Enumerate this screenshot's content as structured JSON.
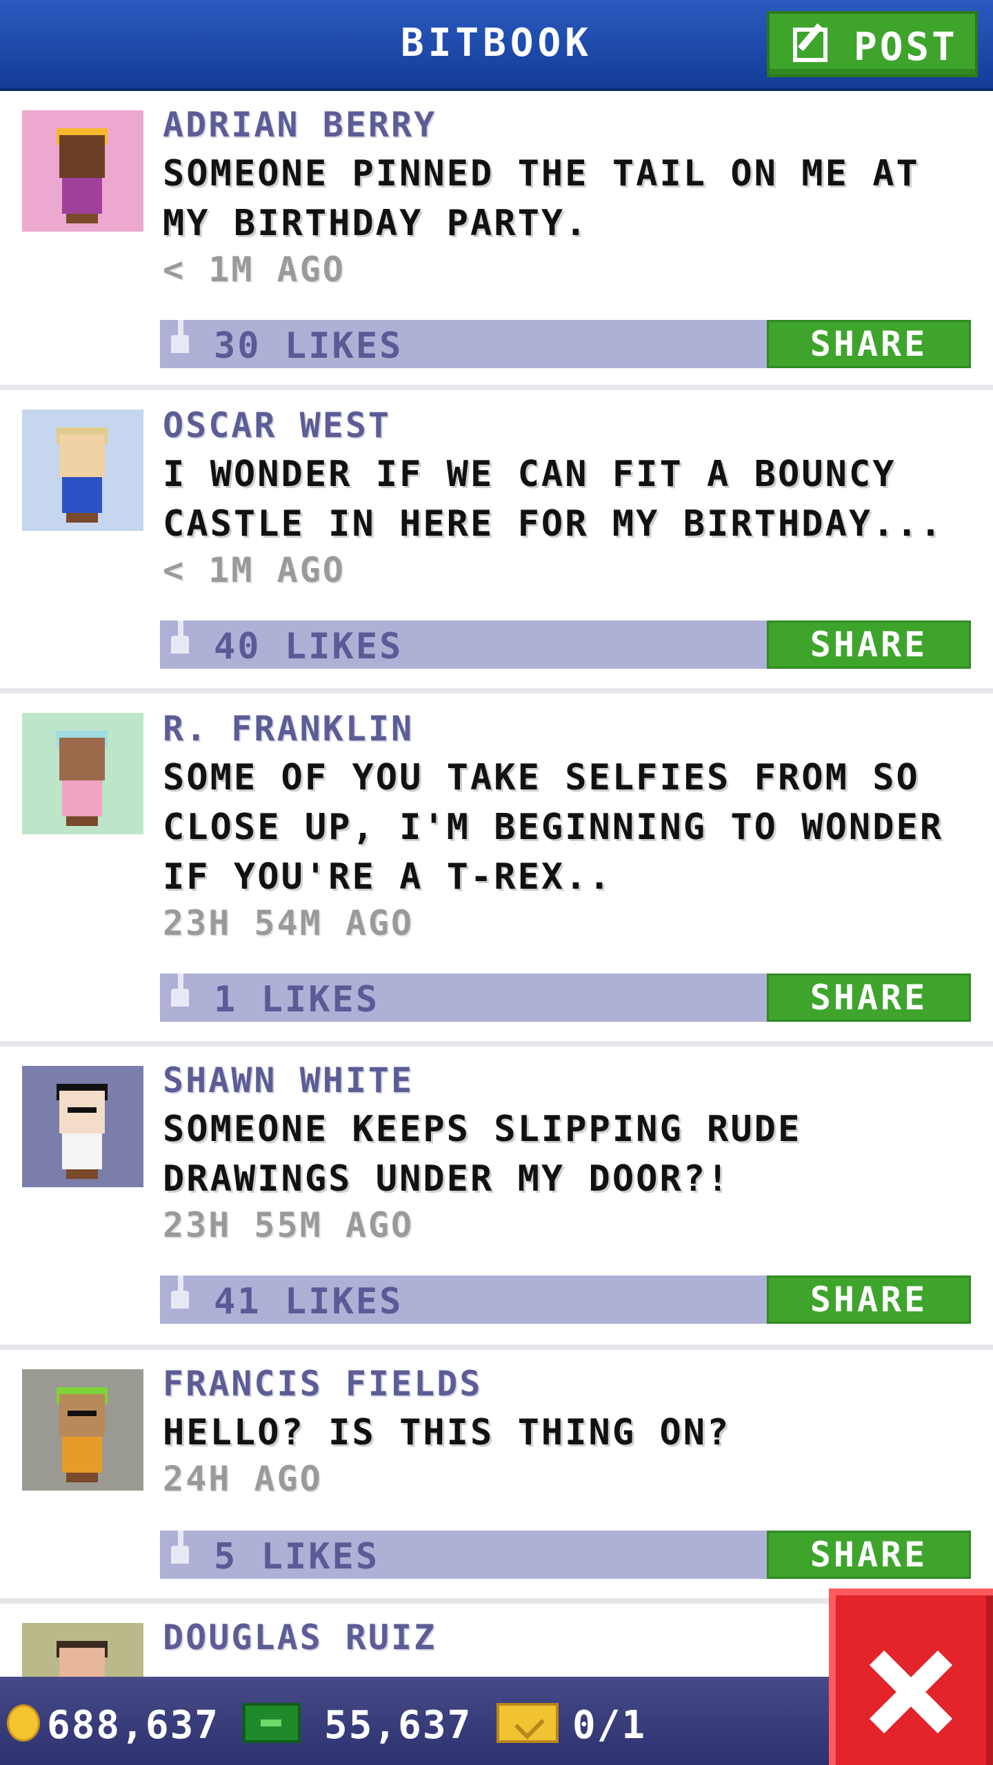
{
  "header": {
    "title": "BITBOOK",
    "post_label": "POST"
  },
  "posts": [
    {
      "author": "ADRIAN BERRY",
      "message": "SOMEONE PINNED THE TAIL ON ME AT MY BIRTHDAY PARTY.",
      "time": "< 1M AGO",
      "likes": "30 LIKES",
      "share_label": "SHARE",
      "avatar_bg": "#eda8cf",
      "skin": "#6b3f24",
      "hair": "#f5b82a",
      "shirt": "#a0409a"
    },
    {
      "author": "OSCAR WEST",
      "message": "I WONDER IF WE CAN FIT A BOUNCY CASTLE IN HERE FOR MY BIRTHDAY...",
      "time": "< 1M AGO",
      "likes": "40 LIKES",
      "share_label": "SHARE",
      "avatar_bg": "#c5d6ee",
      "skin": "#f0d2a4",
      "hair": "#e0cc8c",
      "shirt": "#2a52c4"
    },
    {
      "author": "R. FRANKLIN",
      "message": "SOME OF YOU TAKE SELFIES FROM SO CLOSE UP, I'M BEGINNING TO WONDER IF YOU'RE A T-REX..",
      "time": "23H 54M AGO",
      "likes": "1 LIKES",
      "share_label": "SHARE",
      "avatar_bg": "#bde5c9",
      "skin": "#9b6a4a",
      "hair": "#9fdbe0",
      "shirt": "#f0a3c2"
    },
    {
      "author": "SHAWN WHITE",
      "message": "SOMEONE KEEPS SLIPPING RUDE DRAWINGS UNDER MY DOOR?!",
      "time": "23H 55M AGO",
      "likes": "41 LIKES",
      "share_label": "SHARE",
      "avatar_bg": "#7b7eaa",
      "skin": "#f3dcc8",
      "hair": "#111111",
      "shirt": "#f4f4f4"
    },
    {
      "author": "FRANCIS FIELDS",
      "message": "HELLO? IS THIS THING ON?",
      "time": "24H AGO",
      "likes": "5 LIKES",
      "share_label": "SHARE",
      "avatar_bg": "#9a9a93",
      "skin": "#b88a5a",
      "hair": "#7ed23a",
      "shirt": "#e89a2a"
    },
    {
      "author": "DOUGLAS RUIZ",
      "message": "",
      "time": "",
      "likes": "",
      "share_label": "",
      "avatar_bg": "#b9b98a",
      "skin": "#e8b69a",
      "hair": "#3a2a20",
      "shirt": "#b9b98a"
    }
  ],
  "status_bar": {
    "coins": "688,637",
    "cash": "55,637",
    "tickets": "0/1"
  },
  "colors": {
    "header": "#1e4aab",
    "accent_green": "#3ea42c",
    "likes_bar": "#aeb0d6",
    "close": "#e3242b"
  }
}
